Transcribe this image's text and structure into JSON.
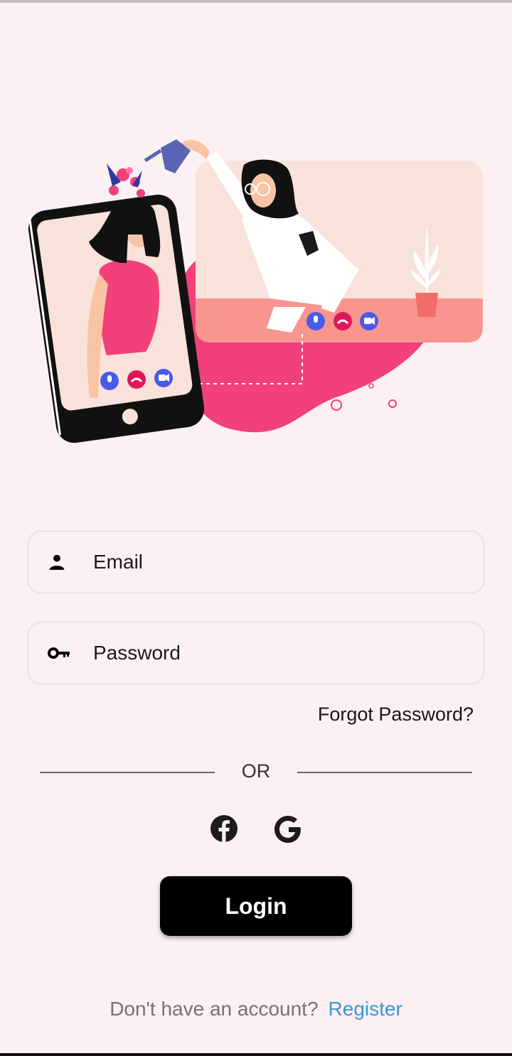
{
  "form": {
    "email_placeholder": "Email",
    "password_placeholder": "Password",
    "forgot_label": "Forgot Password?",
    "or_label": "OR",
    "login_label": "Login"
  },
  "social": {
    "facebook_icon": "facebook-icon",
    "google_icon": "google-icon"
  },
  "footer": {
    "prompt": "Don't have an account?",
    "register_label": "Register"
  },
  "colors": {
    "background": "#fdf0f2",
    "accent_pink": "#f2407a",
    "link_blue": "#3b95d9",
    "button_black": "#000000"
  }
}
